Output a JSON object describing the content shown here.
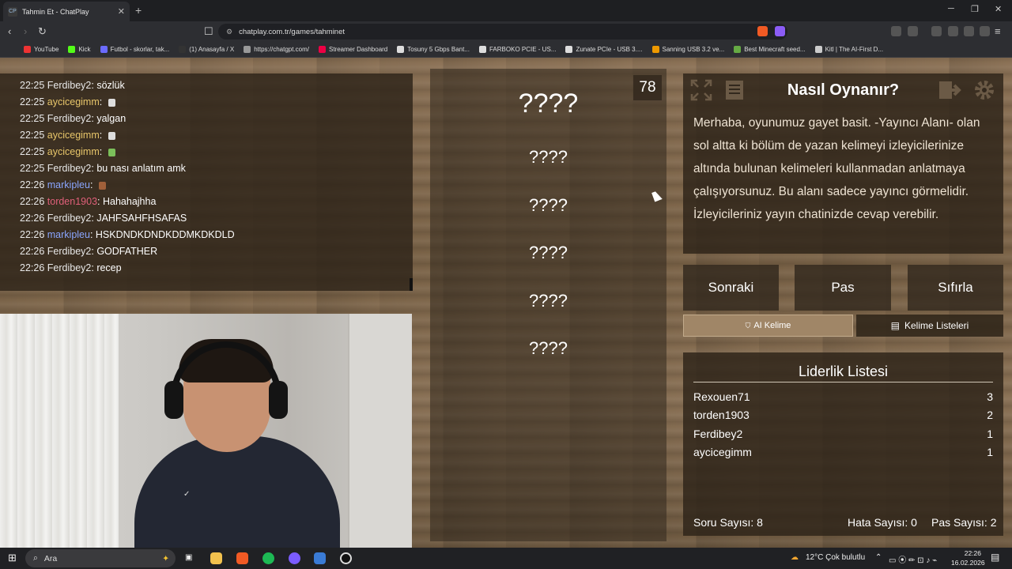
{
  "browser": {
    "tab_title": "Tahmin Et - ChatPlay",
    "tab_favicon": "CP",
    "url": "chatplay.com.tr/games/tahminet",
    "bookmarks": [
      {
        "label": "YouTube",
        "color": "#e33"
      },
      {
        "label": "Kick",
        "color": "#53fc18"
      },
      {
        "label": "Futbol - skorlar, tak...",
        "color": "#6b6bff"
      },
      {
        "label": "(1) Anasayfa / X",
        "color": "#333"
      },
      {
        "label": "https://chatgpt.com/",
        "color": "#999"
      },
      {
        "label": "Streamer Dashboard",
        "color": "#e04"
      },
      {
        "label": "Tosuny 5 Gbps Bant...",
        "color": "#ddd"
      },
      {
        "label": "FARBOKO PCIE - US...",
        "color": "#ddd"
      },
      {
        "label": "Zunate PCIe - USB 3....",
        "color": "#ddd"
      },
      {
        "label": "Sanning USB 3.2 ve...",
        "color": "#e90"
      },
      {
        "label": "Best Minecraft seed...",
        "color": "#6a4"
      },
      {
        "label": "Kitl | The AI-First D...",
        "color": "#ccc"
      }
    ]
  },
  "chat": {
    "messages": [
      {
        "time": "22:25",
        "user": "Ferdibey2",
        "user_color": "#e8e8e8",
        "text": "sözlük",
        "emote": ""
      },
      {
        "time": "22:25",
        "user": "aycicegimm",
        "user_color": "#e8c66a",
        "text": "",
        "emote": "#ddd"
      },
      {
        "time": "22:25",
        "user": "Ferdibey2",
        "user_color": "#e8e8e8",
        "text": "yalgan",
        "emote": ""
      },
      {
        "time": "22:25",
        "user": "aycicegimm",
        "user_color": "#e8c66a",
        "text": "",
        "emote": "#ddd"
      },
      {
        "time": "22:25",
        "user": "aycicegimm",
        "user_color": "#e8c66a",
        "text": "",
        "emote": "#7bbf5a"
      },
      {
        "time": "22:25",
        "user": "Ferdibey2",
        "user_color": "#e8e8e8",
        "text": "bu nası anlatım amk",
        "emote": ""
      },
      {
        "time": "22:26",
        "user": "markipleu",
        "user_color": "#8aa6ff",
        "text": "",
        "emote": "#a0603a"
      },
      {
        "time": "22:26",
        "user": "torden1903",
        "user_color": "#e0607a",
        "text": "Hahahajhha",
        "emote": ""
      },
      {
        "time": "22:26",
        "user": "Ferdibey2",
        "user_color": "#e8e8e8",
        "text": "JAHFSAHFHSAFAS",
        "emote": ""
      },
      {
        "time": "22:26",
        "user": "markipleu",
        "user_color": "#8aa6ff",
        "text": "HSKDNDKDNDKDDMKDKDLD",
        "emote": ""
      },
      {
        "time": "22:26",
        "user": "Ferdibey2",
        "user_color": "#e8e8e8",
        "text": "GODFATHER",
        "emote": ""
      },
      {
        "time": "22:26",
        "user": "Ferdibey2",
        "user_color": "#e8e8e8",
        "text": "recep",
        "emote": ""
      }
    ]
  },
  "game": {
    "counter": "78",
    "main_word": "????",
    "words": [
      "????",
      "????",
      "????",
      "????",
      "????"
    ]
  },
  "howto": {
    "title": "Nasıl Oynanır?",
    "text": "Merhaba, oyunumuz gayet basit. -Yayıncı Alanı- olan sol altta ki bölüm de yazan kelimeyi izleyicilerinize altında bulunan kelimeleri kullanmadan anlatmaya çalışıyorsunuz. Bu alanı sadece yayıncı görmelidir. İzleyicileriniz yayın chatinizde cevap verebilir."
  },
  "controls": {
    "next": "Sonraki",
    "pass": "Pas",
    "reset": "Sıfırla",
    "ai_word": "AI Kelime",
    "word_lists": "Kelime Listeleri"
  },
  "leaderboard": {
    "title": "Liderlik Listesi",
    "rows": [
      {
        "name": "Rexouen71",
        "score": "3"
      },
      {
        "name": "torden1903",
        "score": "2"
      },
      {
        "name": "Ferdibey2",
        "score": "1"
      },
      {
        "name": "aycicegimm",
        "score": "1"
      }
    ]
  },
  "stats": {
    "questions": "Soru Sayısı: 8",
    "errors": "Hata Sayısı: 0",
    "passes": "Pas Sayısı: 2"
  },
  "taskbar": {
    "search_placeholder": "Ara",
    "weather": "12°C  Çok bulutlu",
    "time": "22:26",
    "date": "16.02.2026"
  }
}
